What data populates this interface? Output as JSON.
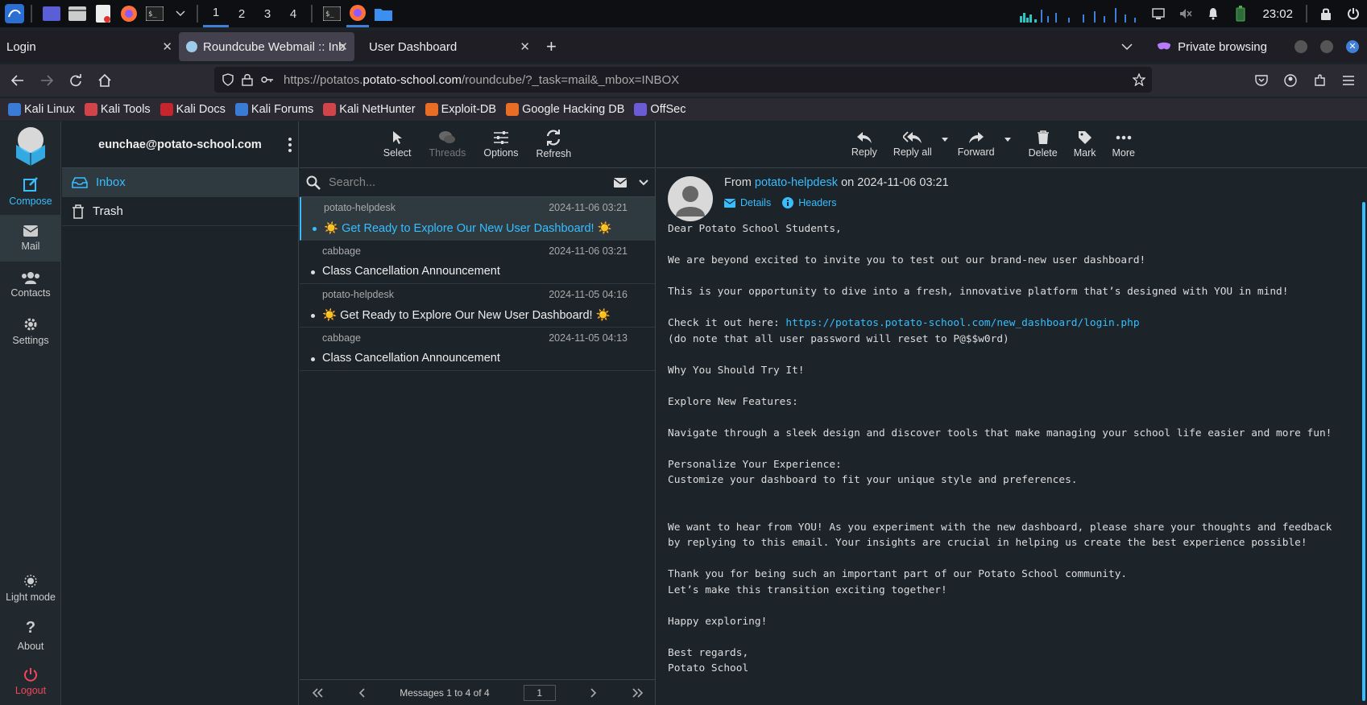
{
  "taskbar": {
    "workspaces": [
      "1",
      "2",
      "3",
      "4"
    ],
    "clock": "23:02"
  },
  "tabs": [
    {
      "title": "Login"
    },
    {
      "title": "Roundcube Webmail :: Inb"
    },
    {
      "title": "User Dashboard"
    }
  ],
  "browser": {
    "private_label": "Private browsing",
    "url_prefix": "https://potatos.",
    "url_domain": "potato-school.com",
    "url_suffix": "/roundcube/?_task=mail&_mbox=INBOX"
  },
  "bookmarks": [
    {
      "label": "Kali Linux",
      "color": "#3a7bd5"
    },
    {
      "label": "Kali Tools",
      "color": "#d0444a"
    },
    {
      "label": "Kali Docs",
      "color": "#c7252e"
    },
    {
      "label": "Kali Forums",
      "color": "#3a7bd5"
    },
    {
      "label": "Kali NetHunter",
      "color": "#d0444a"
    },
    {
      "label": "Exploit-DB",
      "color": "#e96d24"
    },
    {
      "label": "Google Hacking DB",
      "color": "#e96d24"
    },
    {
      "label": "OffSec",
      "color": "#6b5cd6"
    }
  ],
  "leftnav": {
    "compose": "Compose",
    "mail": "Mail",
    "contacts": "Contacts",
    "settings": "Settings",
    "light_mode": "Light mode",
    "about": "About",
    "logout": "Logout"
  },
  "account": "eunchae@potato-school.com",
  "folders": [
    {
      "label": "Inbox"
    },
    {
      "label": "Trash"
    }
  ],
  "list_toolbar": {
    "select": "Select",
    "threads": "Threads",
    "options": "Options",
    "refresh": "Refresh"
  },
  "search": {
    "placeholder": "Search..."
  },
  "messages": [
    {
      "from": "potato-helpdesk",
      "date": "2024-11-06 03:21",
      "subject": "☀️ Get Ready to Explore Our New User Dashboard! ☀️"
    },
    {
      "from": "cabbage",
      "date": "2024-11-06 03:21",
      "subject": "Class Cancellation Announcement"
    },
    {
      "from": "potato-helpdesk",
      "date": "2024-11-05 04:16",
      "subject": "☀️ Get Ready to Explore Our New User Dashboard! ☀️"
    },
    {
      "from": "cabbage",
      "date": "2024-11-05 04:13",
      "subject": "Class Cancellation Announcement"
    }
  ],
  "pager": {
    "count_text": "Messages 1 to 4 of 4",
    "page": "1"
  },
  "reader_toolbar": {
    "reply": "Reply",
    "reply_all": "Reply all",
    "forward": "Forward",
    "delete": "Delete",
    "mark": "Mark",
    "more": "More"
  },
  "email": {
    "from_label": "From",
    "sender": "potato-helpdesk",
    "on_label": "on",
    "date": "2024-11-06 03:21",
    "details": "Details",
    "headers": "Headers",
    "body_1": "Dear Potato School Students,\n\nWe are beyond excited to invite you to test out our brand-new user dashboard!\n\nThis is your opportunity to dive into a fresh, innovative platform that’s designed with YOU in mind!\n\nCheck it out here: ",
    "link": "https://potatos.potato-school.com/new_dashboard/login.php",
    "body_2": "\n(do note that all user password will reset to P@$$w0rd)\n\nWhy You Should Try It!\n\nExplore New Features:\n\nNavigate through a sleek design and discover tools that make managing your school life easier and more fun!\n\nPersonalize Your Experience:\nCustomize your dashboard to fit your unique style and preferences.\n\n\nWe want to hear from YOU! As you experiment with the new dashboard, please share your thoughts and feedback\nby replying to this email. Your insights are crucial in helping us create the best experience possible!\n\nThank you for being such an important part of our Potato School community.\nLet’s make this transition exciting together!\n\nHappy exploring!\n\nBest regards,\nPotato School"
  }
}
